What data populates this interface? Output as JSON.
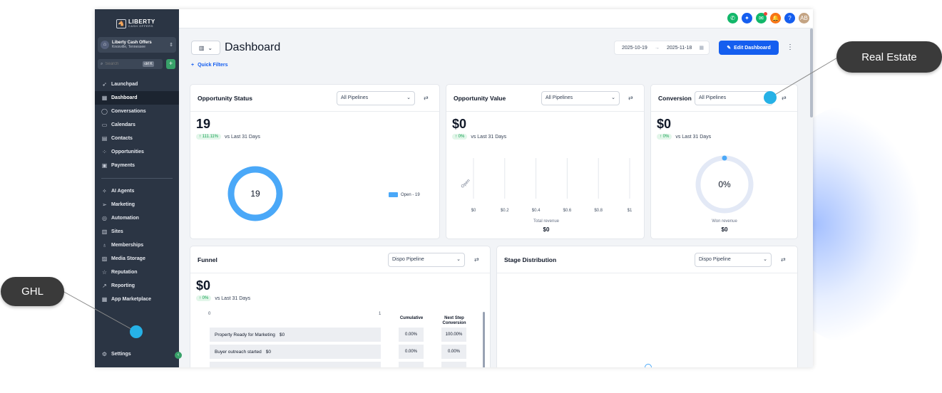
{
  "brand": {
    "logo_line1": "LIBERTY",
    "logo_line2": "CASH OFFERS"
  },
  "account": {
    "name": "Liberty Cash Offers",
    "location": "Knoxville, Tennessee"
  },
  "search": {
    "placeholder": "Search",
    "shortcut": "ctrl K"
  },
  "sidebar": {
    "items": [
      {
        "label": "Launchpad",
        "icon": "rocket-icon"
      },
      {
        "label": "Dashboard",
        "icon": "grid-icon"
      },
      {
        "label": "Conversations",
        "icon": "chat-icon"
      },
      {
        "label": "Calendars",
        "icon": "calendar-icon"
      },
      {
        "label": "Contacts",
        "icon": "contacts-icon"
      },
      {
        "label": "Opportunities",
        "icon": "opportunities-icon"
      },
      {
        "label": "Payments",
        "icon": "payments-icon"
      },
      {
        "label": "AI Agents",
        "icon": "sparkle-icon"
      },
      {
        "label": "Marketing",
        "icon": "send-icon"
      },
      {
        "label": "Automation",
        "icon": "automation-icon"
      },
      {
        "label": "Sites",
        "icon": "sites-icon"
      },
      {
        "label": "Memberships",
        "icon": "badge-icon"
      },
      {
        "label": "Media Storage",
        "icon": "image-icon"
      },
      {
        "label": "Reputation",
        "icon": "star-icon"
      },
      {
        "label": "Reporting",
        "icon": "trend-icon"
      },
      {
        "label": "App Marketplace",
        "icon": "apps-icon"
      }
    ],
    "settings_label": "Settings"
  },
  "header": {
    "title": "Dashboard",
    "quick_filters": "Quick Filters",
    "date_start": "2025-10-19",
    "date_end": "2025-11-18",
    "edit_button": "Edit Dashboard",
    "avatar_initials": "AB"
  },
  "cards": {
    "opportunity_status": {
      "title": "Opportunity Status",
      "filter": "All Pipelines",
      "value": "19",
      "delta": "↑ 111.11%",
      "delta_text": "vs Last 31 Days",
      "donut_label": "19",
      "legend": "Open - 19"
    },
    "opportunity_value": {
      "title": "Opportunity Value",
      "filter": "All Pipelines",
      "value": "$0",
      "delta": "↑ 0%",
      "delta_text": "vs Last 31 Days",
      "axis_label": "Open",
      "ticks": [
        "$0",
        "$0.2",
        "$0.4",
        "$0.6",
        "$0.8",
        "$1"
      ],
      "caption": "Total revenue",
      "total": "$0"
    },
    "conversion": {
      "title": "Conversion",
      "filter": "All Pipelines",
      "value": "$0",
      "delta": "↑ 0%",
      "delta_text": "vs Last 31 Days",
      "gauge_label": "0%",
      "caption": "Won revenue",
      "total": "$0"
    },
    "funnel": {
      "title": "Funnel",
      "filter": "Dispo Pipeline",
      "value": "$0",
      "delta": "↑ 0%",
      "delta_text": "vs Last 31 Days",
      "axis_min": "0",
      "axis_max": "1",
      "col_cumulative": "Cumulative",
      "col_next_1": "Next Step",
      "col_next_2": "Conversion",
      "rows": [
        {
          "stage": "Property Ready for Marketing",
          "amount": "$0",
          "cumulative": "0.00%",
          "next": "100.00%"
        },
        {
          "stage": "Buyer outreach started",
          "amount": "$0",
          "cumulative": "0.00%",
          "next": "0.00%"
        }
      ]
    },
    "stage_distribution": {
      "title": "Stage Distribution",
      "filter": "Dispo Pipeline"
    }
  },
  "chart_data": [
    {
      "type": "pie",
      "title": "Opportunity Status",
      "categories": [
        "Open"
      ],
      "values": [
        19
      ]
    },
    {
      "type": "bar",
      "title": "Opportunity Value",
      "categories": [
        "Open"
      ],
      "values": [
        0
      ],
      "xlabel": "Total revenue",
      "xlim": [
        0,
        1
      ]
    },
    {
      "type": "pie",
      "title": "Conversion",
      "categories": [
        "Won"
      ],
      "values": [
        0
      ]
    }
  ],
  "annotations": {
    "left": "GHL",
    "right": "Real Estate"
  },
  "colors": {
    "sidebar_bg": "#2b3544",
    "primary": "#155eef",
    "donut": "#4aa8f8",
    "callout_bg": "#3a3a3a",
    "marker": "#26b1e6"
  }
}
